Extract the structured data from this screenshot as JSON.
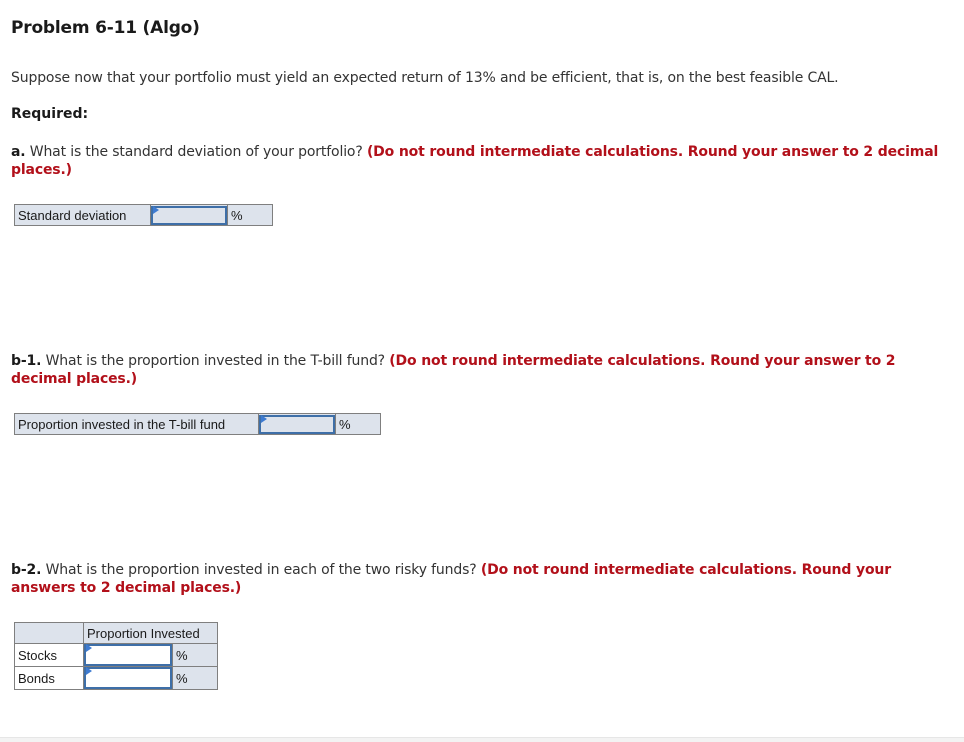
{
  "problem": {
    "title": "Problem 6-11 (Algo)",
    "intro": "Suppose now that your portfolio must yield an expected return of 13% and be efficient, that is, on the best feasible CAL.",
    "required_label": "Required:"
  },
  "questions": {
    "a": {
      "label": "a.",
      "text": " What is the standard deviation of your portfolio? ",
      "instruction": "(Do not round intermediate calculations. Round your answer to 2 decimal places.)",
      "table": {
        "row_label": "Standard deviation",
        "value": "",
        "unit": "%"
      }
    },
    "b1": {
      "label": "b-1.",
      "text": " What is the proportion invested in the T-bill fund? ",
      "instruction": "(Do not round intermediate calculations. Round your answer to 2 decimal places.)",
      "table": {
        "row_label": "Proportion invested in the T-bill fund",
        "value": "",
        "unit": "%"
      }
    },
    "b2": {
      "label": "b-2.",
      "text": " What is the proportion invested in each of the two risky funds? ",
      "instruction": "(Do not round intermediate calculations. Round your answers to 2 decimal places.)",
      "table": {
        "header": "Proportion Invested",
        "rows": [
          {
            "label": "Stocks",
            "value": "",
            "unit": "%"
          },
          {
            "label": "Bonds",
            "value": "",
            "unit": "%"
          }
        ]
      }
    }
  },
  "colors": {
    "instruction_red": "#b2101a",
    "input_border_blue": "#3e6fa8",
    "table_fill": "#dde3ec"
  }
}
